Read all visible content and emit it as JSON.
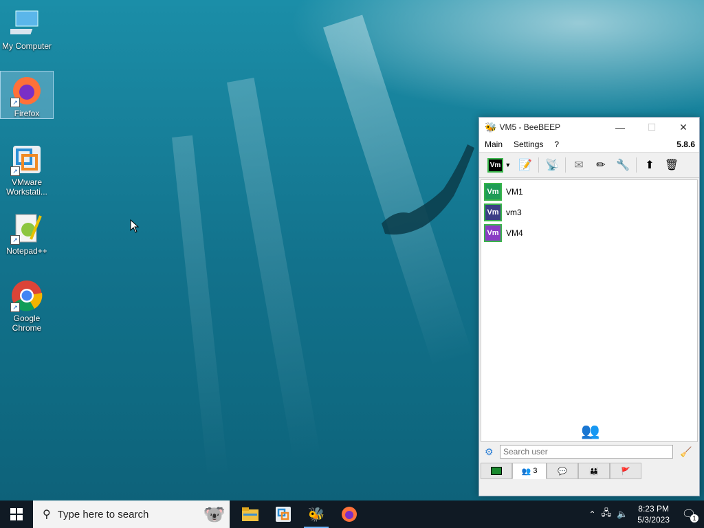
{
  "desktop": {
    "icons": [
      {
        "label": "My Computer",
        "icon": "computer-icon"
      },
      {
        "label": "Firefox",
        "icon": "firefox-icon"
      },
      {
        "label": "VMware Workstati...",
        "icon": "vmware-icon"
      },
      {
        "label": "Notepad++",
        "icon": "notepadpp-icon"
      },
      {
        "label": "Google Chrome",
        "icon": "chrome-icon"
      }
    ]
  },
  "window": {
    "title": "VM5 - BeeBEEP",
    "menu": [
      "Main",
      "Settings",
      "?"
    ],
    "version": "5.8.6",
    "users": [
      {
        "name": "VM1",
        "avatar": "Vm",
        "color": "#1f9c57"
      },
      {
        "name": "vm3",
        "avatar": "Vm",
        "color": "#3b3f86"
      },
      {
        "name": "VM4",
        "avatar": "Vm",
        "color": "#8a3cc4"
      }
    ],
    "status_avatar": "Vm",
    "search_placeholder": "Search user",
    "tab_user_count": "3"
  },
  "taskbar": {
    "search_placeholder": "Type here to search",
    "time": "8:23 PM",
    "date": "5/3/2023",
    "notification_count": "1"
  }
}
